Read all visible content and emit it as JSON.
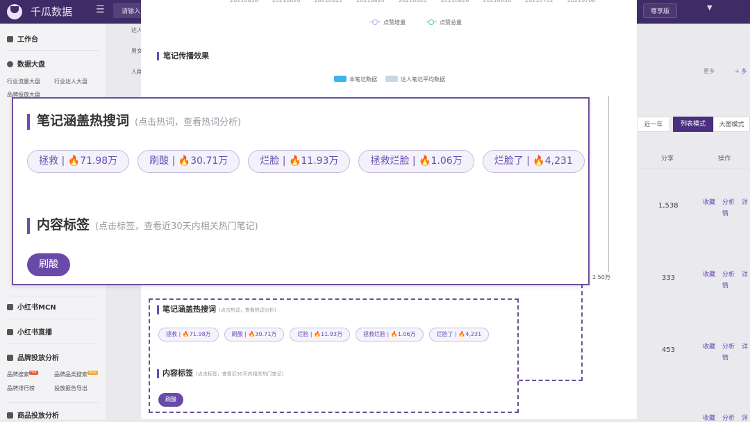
{
  "topbar": {
    "brand": "千瓜数据",
    "menu_icon": "menu-icon",
    "search_placeholder": "请输入",
    "version_badge": "尊享版",
    "caret_icon": "caret-down-icon"
  },
  "sidebar": {
    "workbench": "工作台",
    "data_board": "数据大盘",
    "industry_traffic": "行业流量大盘",
    "industry_kol": "行业达人大盘",
    "brand_ads": "品牌投放大盘",
    "mcn": "小红书MCN",
    "live": "小红书直播",
    "brand_analysis": "品牌投放分析",
    "brand_search": "品牌搜索",
    "hot_badge": "Hot",
    "category_search": "品牌品类搜索",
    "new_badge": "New",
    "brand_rank": "品牌排行榜",
    "ad_report": "投放报告导出",
    "product_analysis": "商品投放分析"
  },
  "chart": {
    "dates": [
      "20210818",
      "20210820",
      "20210822",
      "20210824",
      "20210826",
      "20210828",
      "20210830",
      "20210702",
      "20210706"
    ],
    "legend_like_increase": "点赞增量",
    "legend_like_total": "点赞总量",
    "spread_title": "笔记传播效果",
    "legend_this_note": "本笔记数据",
    "legend_avg": "达人笔记平均数据",
    "axis_value": "2.50万",
    "color_this_note": "#3bb5ea",
    "color_avg": "#c9d6e6",
    "color_increase": "#9fb6e0",
    "color_total": "#58c4a2"
  },
  "center_left": {
    "row1": "达人",
    "row2": "男女",
    "row3": "人群"
  },
  "keywords": {
    "title": "笔记涵盖热搜词",
    "hint": "(点击热词，查看热词分析)",
    "chips": [
      {
        "label": "拯救 | ",
        "icon": "fire-icon",
        "value": "71.98万"
      },
      {
        "label": "刷酸 | ",
        "icon": "fire-icon",
        "value": "30.71万"
      },
      {
        "label": "烂脸 | ",
        "icon": "fire-icon",
        "value": "11.93万"
      },
      {
        "label": "拯救烂脸 | ",
        "icon": "fire-icon",
        "value": "1.06万"
      },
      {
        "label": "烂脸了 | ",
        "icon": "fire-icon",
        "value": "4,231"
      }
    ]
  },
  "tags": {
    "title": "内容标签",
    "hint": "(点击标签，查看近30天内相关热门笔记)",
    "items": [
      "刷酸"
    ]
  },
  "right": {
    "more": "更多",
    "more_plus": "+ 多",
    "year_btn": "近一年",
    "list_mode": "列表模式",
    "grid_mode": "大图模式",
    "col_share": "分享",
    "col_ops": "操作",
    "rows": [
      {
        "share": "1,538",
        "fav": "收藏",
        "analyze": "分析",
        "detail": "详"
      },
      {
        "share": "333",
        "fav": "收藏",
        "analyze": "分析",
        "detail": "详"
      },
      {
        "share": "453",
        "fav": "收藏",
        "analyze": "分析",
        "detail": "详"
      },
      {
        "share": "",
        "fav": "收藏",
        "analyze": "分析",
        "detail": "详"
      }
    ],
    "row_suffix": "情"
  },
  "accent": "#6a4aa8"
}
